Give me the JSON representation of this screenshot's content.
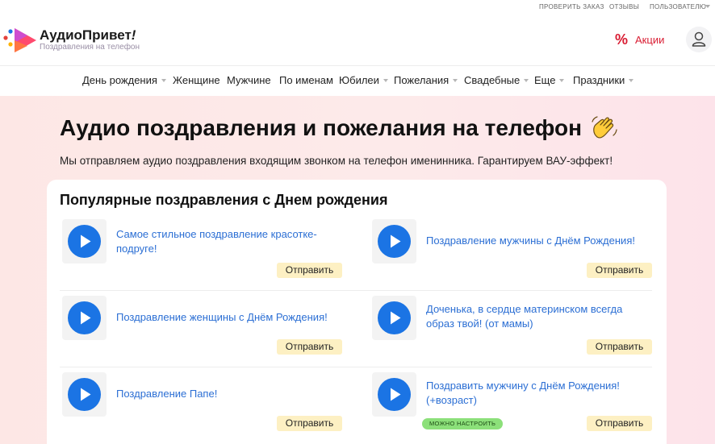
{
  "top_links": {
    "check_order": "ПРОВЕРИТЬ ЗАКАЗ",
    "reviews": "ОТЗЫВЫ",
    "user": "ПОЛЬЗОВАТЕЛЮ"
  },
  "header": {
    "brand_name": "АудиоПривет",
    "brand_mark": "!",
    "tagline": "Поздравления на телефон",
    "promo_symbol": "%",
    "promo_label": "Акции"
  },
  "nav": {
    "items": [
      {
        "label": "День рождения",
        "has_dropdown": true
      },
      {
        "label": "Женщине",
        "has_dropdown": false
      },
      {
        "label": "Мужчине",
        "has_dropdown": false
      },
      {
        "label": "По именам",
        "has_dropdown": false
      },
      {
        "label": "Юбилеи",
        "has_dropdown": true
      },
      {
        "label": "Пожелания",
        "has_dropdown": true
      },
      {
        "label": "Свадебные",
        "has_dropdown": true
      },
      {
        "label": "Еще",
        "has_dropdown": true
      },
      {
        "label": "Праздники",
        "has_dropdown": true
      }
    ]
  },
  "hero": {
    "title": "Аудио поздравления и пожелания на телефон",
    "title_emoji": "waving-hand-icon",
    "subtitle": "Мы отправляем аудио поздравления входящим звонком на телефон именинника. Гарантируем ВАУ-эффект!"
  },
  "popular": {
    "title": "Популярные поздравления с Днем рождения",
    "items": [
      {
        "title": "Самое стильное поздравление красотке-подруге!",
        "button": "Отправить",
        "badge": ""
      },
      {
        "title": "Поздравление мужчины с Днём Рождения!",
        "button": "Отправить",
        "badge": ""
      },
      {
        "title": "Поздравление женщины с Днём Рождения!",
        "button": "Отправить",
        "badge": ""
      },
      {
        "title": "Доченька, в сердце материнском всегда образ твой! (от мамы)",
        "button": "Отправить",
        "badge": ""
      },
      {
        "title": "Поздравление Папе!",
        "button": "Отправить",
        "badge": ""
      },
      {
        "title": "Поздравить мужчину с Днём Рождения! (+возраст)",
        "button": "Отправить",
        "badge": "МОЖНО НАСТРОИТЬ"
      }
    ]
  },
  "colors": {
    "accent_blue": "#1b74e4",
    "link_blue": "#2c6fd4",
    "promo_red": "#d91c32",
    "button_yellow": "#fdf0c3",
    "badge_green": "#8ce07a",
    "hero_bg": "#fde7e5"
  }
}
